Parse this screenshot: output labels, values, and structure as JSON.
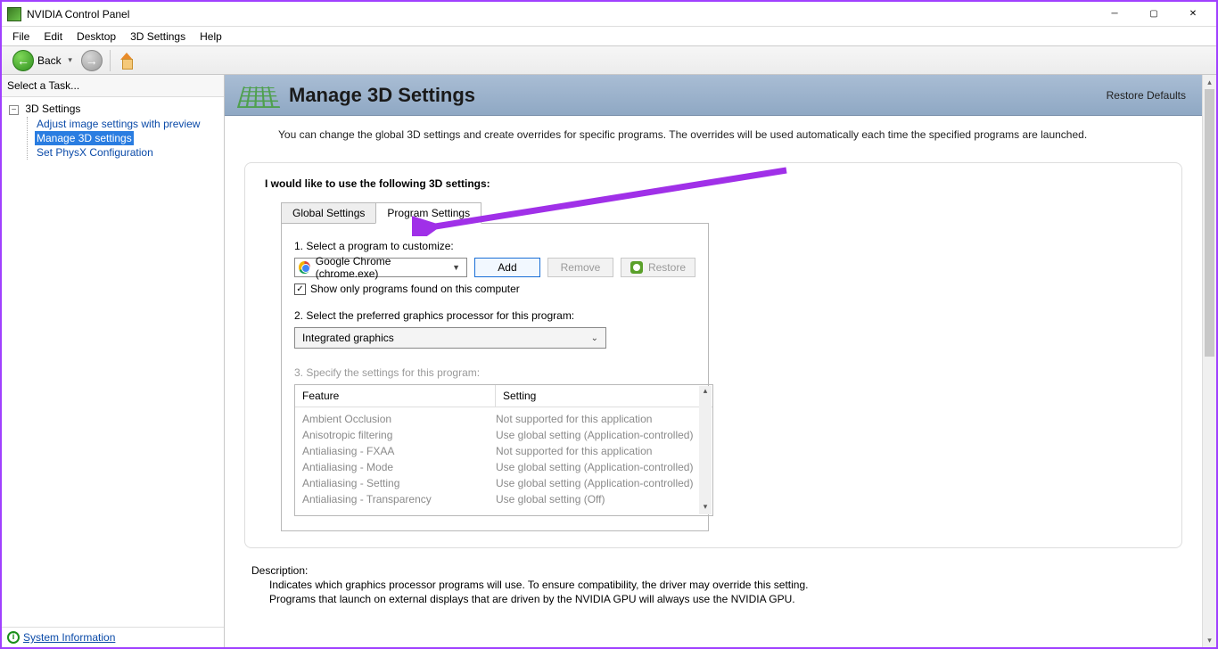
{
  "window": {
    "title": "NVIDIA Control Panel"
  },
  "menu": {
    "file": "File",
    "edit": "Edit",
    "desktop": "Desktop",
    "settings3d": "3D Settings",
    "help": "Help"
  },
  "toolbar": {
    "back": "Back"
  },
  "sidebar": {
    "header": "Select a Task...",
    "root": "3D Settings",
    "items": [
      {
        "label": "Adjust image settings with preview"
      },
      {
        "label": "Manage 3D settings"
      },
      {
        "label": "Set PhysX Configuration"
      }
    ],
    "sysinfo": "System Information"
  },
  "page": {
    "title": "Manage 3D Settings",
    "restore": "Restore Defaults",
    "intro": "You can change the global 3D settings and create overrides for specific programs. The overrides will be used automatically each time the specified programs are launched.",
    "subheading": "I would like to use the following 3D settings:"
  },
  "tabs": {
    "global": "Global Settings",
    "program": "Program Settings"
  },
  "step1": {
    "label": "1. Select a program to customize:",
    "selected": "Google Chrome (chrome.exe)",
    "add": "Add",
    "remove": "Remove",
    "restore": "Restore",
    "checkbox": "Show only programs found on this computer"
  },
  "step2": {
    "label": "2. Select the preferred graphics processor for this program:",
    "selected": "Integrated graphics"
  },
  "step3": {
    "label": "3. Specify the settings for this program:",
    "headers": {
      "feature": "Feature",
      "setting": "Setting"
    },
    "rows": [
      {
        "f": "Ambient Occlusion",
        "s": "Not supported for this application"
      },
      {
        "f": "Anisotropic filtering",
        "s": "Use global setting (Application-controlled)"
      },
      {
        "f": "Antialiasing - FXAA",
        "s": "Not supported for this application"
      },
      {
        "f": "Antialiasing - Mode",
        "s": "Use global setting (Application-controlled)"
      },
      {
        "f": "Antialiasing - Setting",
        "s": "Use global setting (Application-controlled)"
      },
      {
        "f": "Antialiasing - Transparency",
        "s": "Use global setting (Off)"
      }
    ]
  },
  "description": {
    "heading": "Description:",
    "line1": "Indicates which graphics processor programs will use. To ensure compatibility, the driver may override this setting.",
    "line2": "Programs that launch on external displays that are driven by the NVIDIA GPU will always use the NVIDIA GPU."
  }
}
